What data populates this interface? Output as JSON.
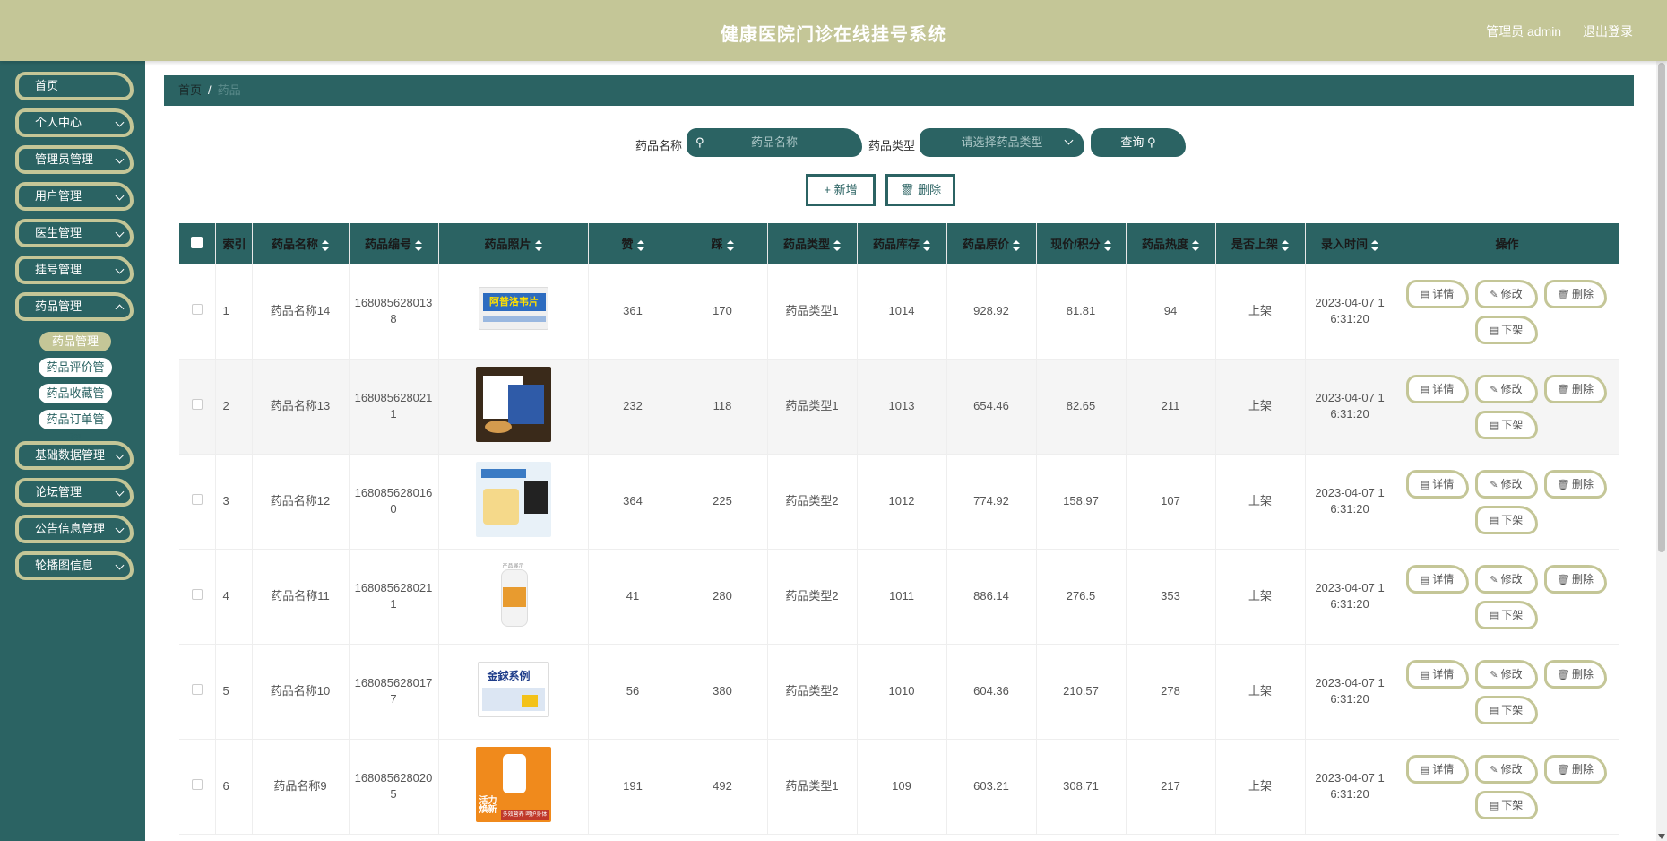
{
  "header": {
    "title": "健康医院门诊在线挂号系统",
    "user": "管理员 admin",
    "logout": "退出登录"
  },
  "sidebar": {
    "items": [
      {
        "label": "首页"
      },
      {
        "label": "个人中心"
      },
      {
        "label": "管理员管理"
      },
      {
        "label": "用户管理"
      },
      {
        "label": "医生管理"
      },
      {
        "label": "挂号管理"
      },
      {
        "label": "药品管理"
      },
      {
        "label": "基础数据管理"
      },
      {
        "label": "论坛管理"
      },
      {
        "label": "公告信息管理"
      },
      {
        "label": "轮播图信息"
      }
    ],
    "subitems": [
      {
        "label": "药品管理",
        "active": true
      },
      {
        "label": "药品评价管理"
      },
      {
        "label": "药品收藏管理"
      },
      {
        "label": "药品订单管理"
      }
    ]
  },
  "breadcrumb": {
    "home": "首页",
    "sep": "/",
    "current": "药品"
  },
  "search": {
    "name_label": "药品名称",
    "name_placeholder": "药品名称",
    "type_label": "药品类型",
    "type_placeholder": "请选择药品类型",
    "query": "查询"
  },
  "actions": {
    "add": "新增",
    "delete": "删除"
  },
  "table": {
    "headers": [
      "索引",
      "药品名称",
      "药品编号",
      "药品照片",
      "赞",
      "踩",
      "药品类型",
      "药品库存",
      "药品原价",
      "现价/积分",
      "药品热度",
      "是否上架",
      "录入时间",
      "操作"
    ],
    "rows": [
      {
        "index": "1",
        "name": "药品名称14",
        "code": "1680856280138",
        "up": "361",
        "down": "170",
        "type": "药品类型1",
        "stock": "1014",
        "price": "928.92",
        "now": "81.81",
        "heat": "94",
        "shelf": "上架",
        "time": "2023-04-07 16:31:20"
      },
      {
        "index": "2",
        "name": "药品名称13",
        "code": "1680856280211",
        "up": "232",
        "down": "118",
        "type": "药品类型1",
        "stock": "1013",
        "price": "654.46",
        "now": "82.65",
        "heat": "211",
        "shelf": "上架",
        "time": "2023-04-07 16:31:20"
      },
      {
        "index": "3",
        "name": "药品名称12",
        "code": "1680856280160",
        "up": "364",
        "down": "225",
        "type": "药品类型2",
        "stock": "1012",
        "price": "774.92",
        "now": "158.97",
        "heat": "107",
        "shelf": "上架",
        "time": "2023-04-07 16:31:20"
      },
      {
        "index": "4",
        "name": "药品名称11",
        "code": "1680856280211",
        "up": "41",
        "down": "280",
        "type": "药品类型2",
        "stock": "1011",
        "price": "886.14",
        "now": "276.5",
        "heat": "353",
        "shelf": "上架",
        "time": "2023-04-07 16:31:20"
      },
      {
        "index": "5",
        "name": "药品名称10",
        "code": "1680856280177",
        "up": "56",
        "down": "380",
        "type": "药品类型2",
        "stock": "1010",
        "price": "604.36",
        "now": "210.57",
        "heat": "278",
        "shelf": "上架",
        "time": "2023-04-07 16:31:20"
      },
      {
        "index": "6",
        "name": "药品名称9",
        "code": "1680856280205",
        "up": "191",
        "down": "492",
        "type": "药品类型1",
        "stock": "109",
        "price": "603.21",
        "now": "308.71",
        "heat": "217",
        "shelf": "上架",
        "time": "2023-04-07 16:31:20"
      }
    ],
    "ops": {
      "detail": "详情",
      "edit": "修改",
      "delete": "删除",
      "off": "下架"
    }
  },
  "images": {
    "img1_text": "阿普洛韦片",
    "img5_text": "金銶系例",
    "img6_text_a": "活力",
    "img6_text_b": "焕新",
    "img6_text_c": "多效营养 呵护身体",
    "img4_text": "产品展示"
  },
  "colors": {
    "header": "#c4c697",
    "primary": "#2b6363",
    "accent": "#c4c697"
  }
}
